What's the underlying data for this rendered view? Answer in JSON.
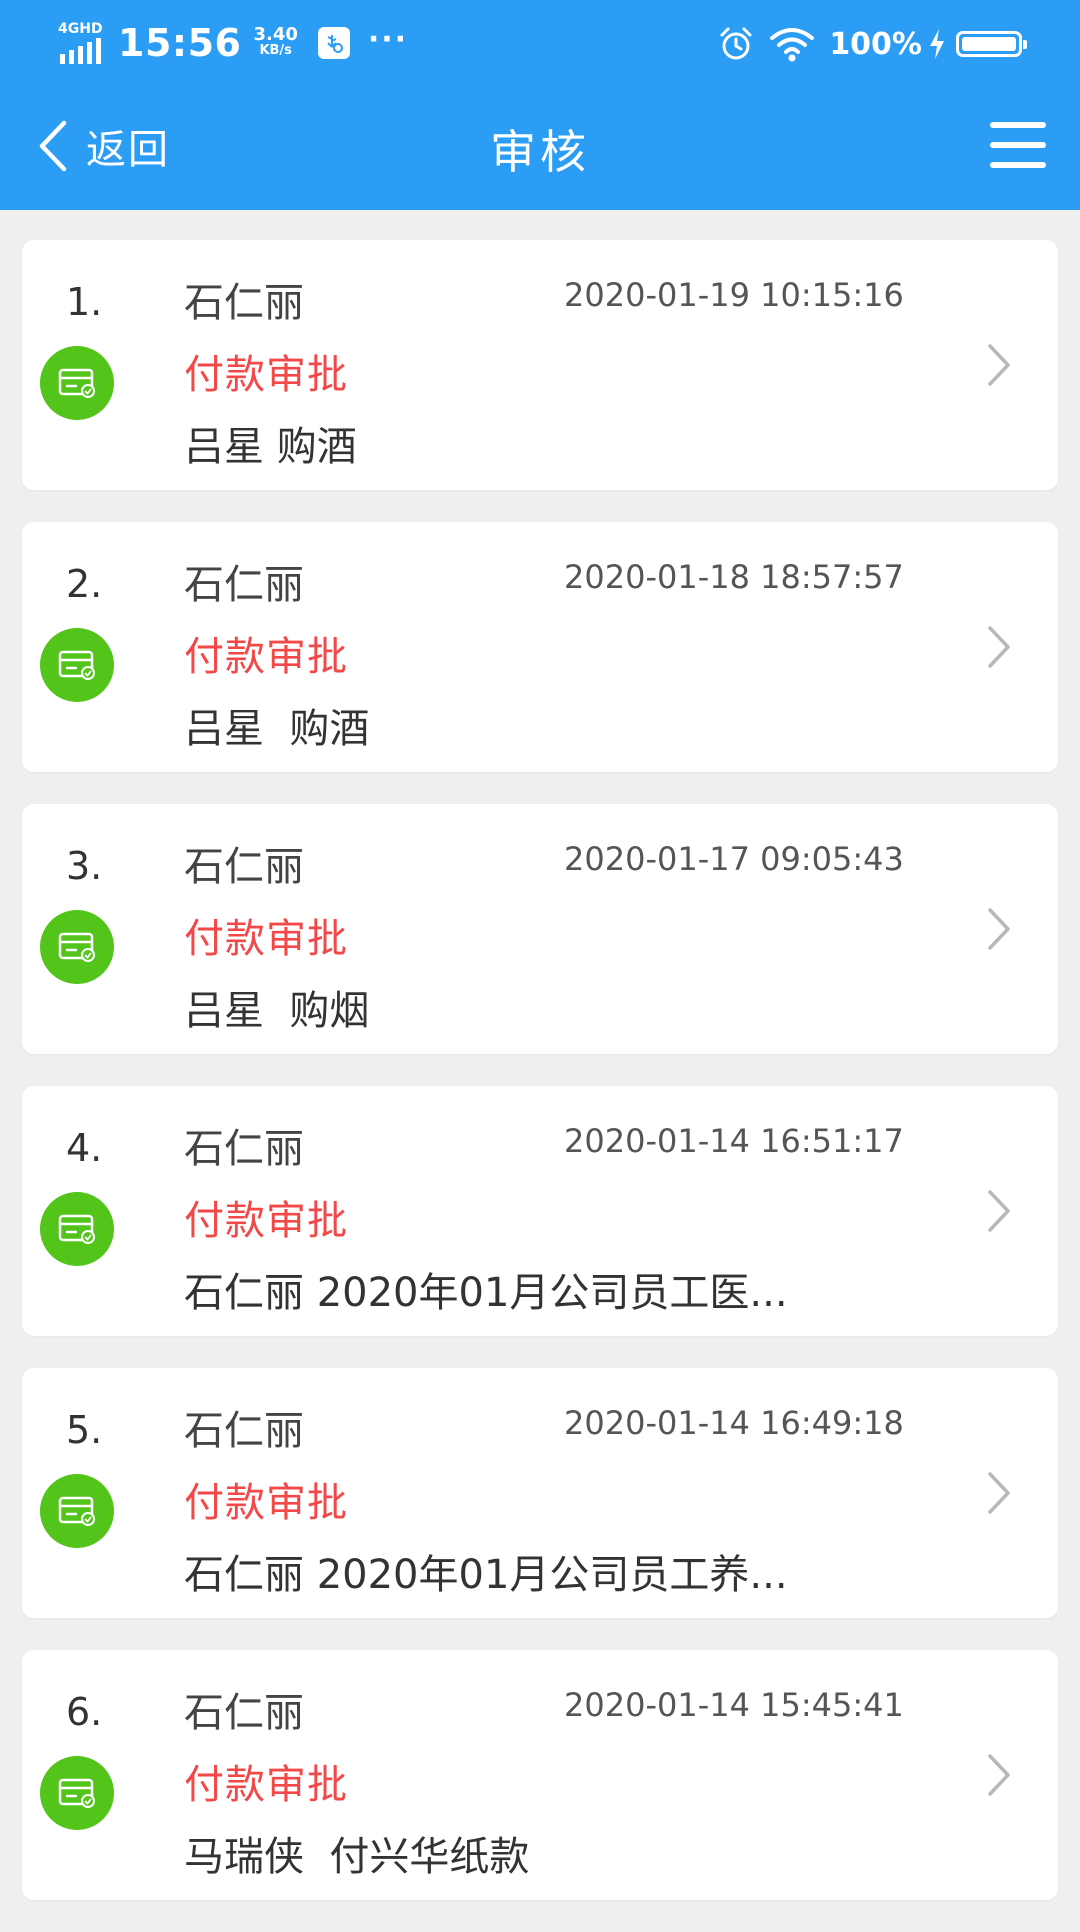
{
  "status_bar": {
    "network": "4GHD",
    "time": "15:56",
    "speed_value": "3.40",
    "speed_unit": "KB/s",
    "more": "···",
    "battery": "100%"
  },
  "nav": {
    "back_label": "返回",
    "title": "审核"
  },
  "items": [
    {
      "index": "1.",
      "name": "石仁丽",
      "time": "2020-01-19 10:15:16",
      "type": "付款审批",
      "desc": "吕星 购酒"
    },
    {
      "index": "2.",
      "name": "石仁丽",
      "time": "2020-01-18 18:57:57",
      "type": "付款审批",
      "desc": "吕星  购酒"
    },
    {
      "index": "3.",
      "name": "石仁丽",
      "time": "2020-01-17 09:05:43",
      "type": "付款审批",
      "desc": "吕星  购烟"
    },
    {
      "index": "4.",
      "name": "石仁丽",
      "time": "2020-01-14 16:51:17",
      "type": "付款审批",
      "desc": "石仁丽 2020年01月公司员工医..."
    },
    {
      "index": "5.",
      "name": "石仁丽",
      "time": "2020-01-14 16:49:18",
      "type": "付款审批",
      "desc": "石仁丽 2020年01月公司员工养..."
    },
    {
      "index": "6.",
      "name": "石仁丽",
      "time": "2020-01-14 15:45:41",
      "type": "付款审批",
      "desc": "马瑞侠  付兴华纸款"
    }
  ],
  "colors": {
    "header": "#2b9df5",
    "badge": "#52c41a",
    "type_text": "#f24848",
    "background": "#efefef"
  }
}
